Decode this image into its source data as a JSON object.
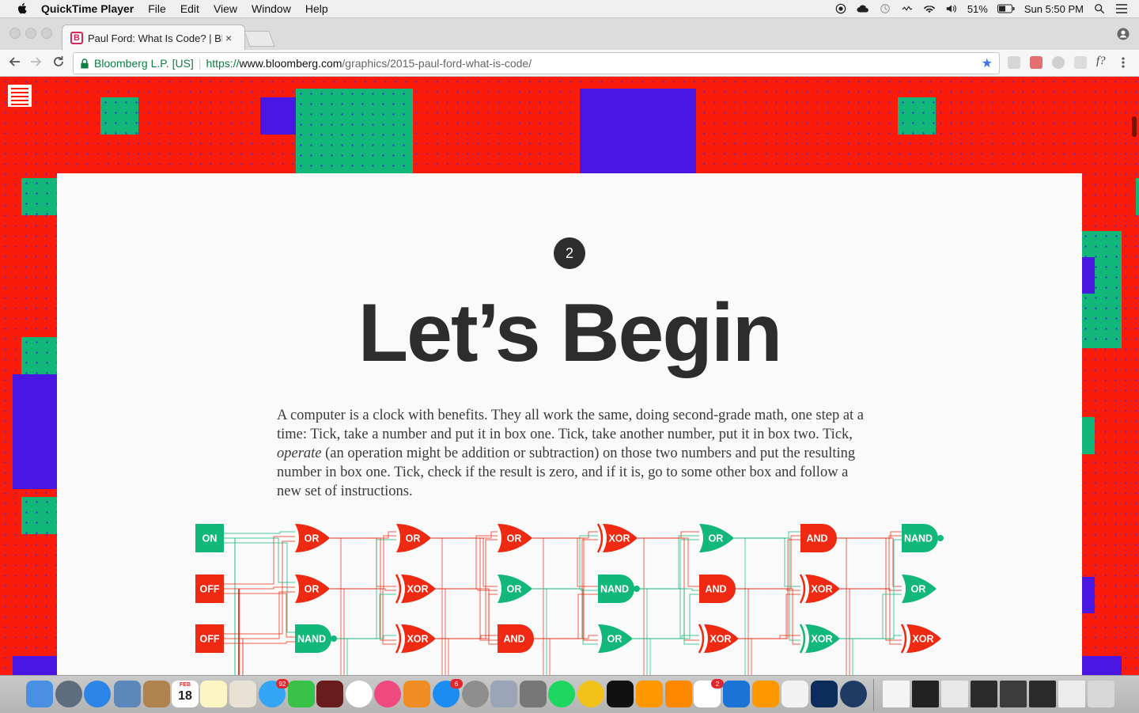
{
  "menubar": {
    "app_name": "QuickTime Player",
    "items": [
      "File",
      "Edit",
      "View",
      "Window",
      "Help"
    ],
    "battery": "51%",
    "clock": "Sun 5:50 PM"
  },
  "browser": {
    "tab_title": "Paul Ford: What Is Code? | Bl",
    "tab_favicon": "B",
    "tab_close": "×",
    "origin_label": "Bloomberg L.P. [US]",
    "url_scheme": "https://",
    "url_host": "www.bloomberg.com",
    "url_path": "/graphics/2015-paul-ford-what-is-code/",
    "bookmark_star": "★",
    "ext_label": "f?"
  },
  "article": {
    "chapter_number": "2",
    "headline": "Let’s Begin",
    "body_part1": "A computer is a clock with benefits. They all work the same, doing second-grade math, one step at a time: Tick, take a number and put it in box one. Tick, take another number, put it in box two. Tick, ",
    "body_emphasis": "operate",
    "body_part2": " (an operation might be addition or subtraction) on those two numbers and put the resulting number in box one. Tick, check if the result is zero, and if it is, go to some other box and follow a new set of instructions."
  },
  "circuit": {
    "inputs": [
      {
        "label": "ON",
        "color": "#11b87a"
      },
      {
        "label": "OFF",
        "color": "#f02a12"
      },
      {
        "label": "OFF",
        "color": "#f02a12"
      }
    ],
    "columns": [
      [
        {
          "label": "OR",
          "color": "#f02a12"
        },
        {
          "label": "OR",
          "color": "#f02a12"
        },
        {
          "label": "NAND",
          "color": "#11b87a"
        }
      ],
      [
        {
          "label": "OR",
          "color": "#f02a12"
        },
        {
          "label": "XOR",
          "color": "#f02a12"
        },
        {
          "label": "XOR",
          "color": "#f02a12"
        }
      ],
      [
        {
          "label": "OR",
          "color": "#f02a12"
        },
        {
          "label": "OR",
          "color": "#11b87a"
        },
        {
          "label": "AND",
          "color": "#f02a12"
        }
      ],
      [
        {
          "label": "XOR",
          "color": "#f02a12"
        },
        {
          "label": "NAND",
          "color": "#11b87a"
        },
        {
          "label": "OR",
          "color": "#11b87a"
        }
      ],
      [
        {
          "label": "OR",
          "color": "#11b87a"
        },
        {
          "label": "AND",
          "color": "#f02a12"
        },
        {
          "label": "XOR",
          "color": "#f02a12"
        }
      ],
      [
        {
          "label": "AND",
          "color": "#f02a12"
        },
        {
          "label": "XOR",
          "color": "#f02a12"
        },
        {
          "label": "XOR",
          "color": "#11b87a"
        }
      ],
      [
        {
          "label": "NAND",
          "color": "#11b87a"
        },
        {
          "label": "OR",
          "color": "#11b87a"
        },
        {
          "label": "XOR",
          "color": "#f02a12"
        }
      ]
    ]
  },
  "dock": {
    "calendar_day": "18",
    "calendar_month": "FEB",
    "badges": {
      "messages": "92",
      "appstore": "6",
      "slack": "2"
    }
  },
  "colors": {
    "page_red": "#fb1b0a",
    "green": "#11b87a",
    "blue": "#4a16e2",
    "card": "#fafafa",
    "headline": "#2d2d2d"
  }
}
